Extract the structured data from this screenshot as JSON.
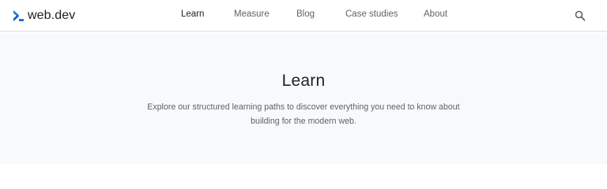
{
  "header": {
    "logo_text": "web.dev",
    "nav": [
      {
        "label": "Learn",
        "active": true
      },
      {
        "label": "Measure",
        "active": false
      },
      {
        "label": "Blog",
        "active": false
      },
      {
        "label": "Case studies",
        "active": false
      },
      {
        "label": "About",
        "active": false
      }
    ],
    "search_icon": "search-icon"
  },
  "hero": {
    "title": "Learn",
    "description": "Explore our structured learning paths to discover everything you need to know about building for the modern web."
  },
  "colors": {
    "brand_blue": "#1a73e8",
    "brand_dark_blue": "#0b57d0",
    "text_primary": "#202124",
    "text_secondary": "#5f6368",
    "hero_background": "#f8f9fa",
    "divider": "#dadce0"
  }
}
